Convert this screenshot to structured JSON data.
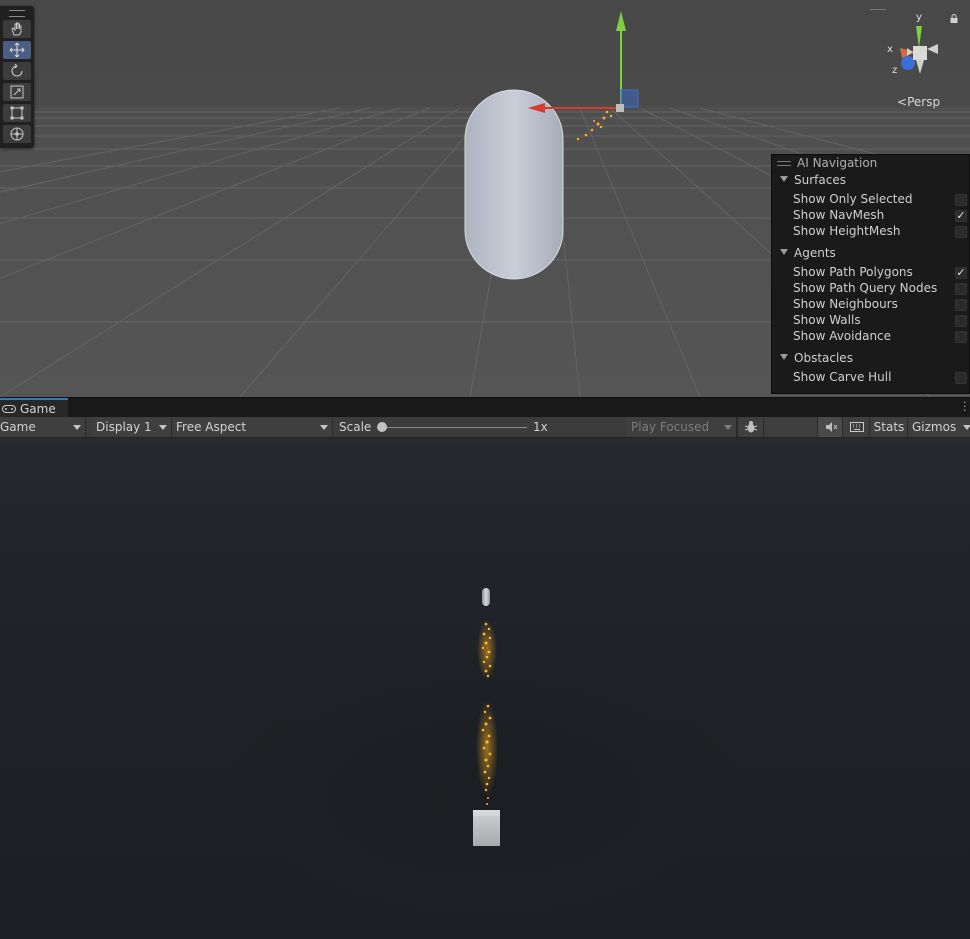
{
  "scene": {
    "camera_label": "Persp",
    "axis_labels": {
      "x": "x",
      "y": "y",
      "z": "z"
    },
    "tools": [
      {
        "name": "hand-tool",
        "icon": "hand-icon"
      },
      {
        "name": "move-tool",
        "icon": "move-icon",
        "active": true
      },
      {
        "name": "rotate-tool",
        "icon": "rotate-icon"
      },
      {
        "name": "scale-tool",
        "icon": "scale-icon"
      },
      {
        "name": "rect-tool",
        "icon": "rect-icon"
      },
      {
        "name": "transform-tool",
        "icon": "transform-icon"
      }
    ],
    "ai_navigation": {
      "title": "AI Navigation",
      "sections": [
        {
          "label": "Surfaces",
          "options": [
            {
              "label": "Show Only Selected",
              "checked": false
            },
            {
              "label": "Show NavMesh",
              "checked": true
            },
            {
              "label": "Show HeightMesh",
              "checked": false
            }
          ]
        },
        {
          "label": "Agents",
          "options": [
            {
              "label": "Show Path Polygons",
              "checked": true
            },
            {
              "label": "Show Path Query Nodes",
              "checked": false
            },
            {
              "label": "Show Neighbours",
              "checked": false
            },
            {
              "label": "Show Walls",
              "checked": false
            },
            {
              "label": "Show Avoidance",
              "checked": false
            }
          ]
        },
        {
          "label": "Obstacles",
          "options": [
            {
              "label": "Show Carve Hull",
              "checked": false
            }
          ]
        }
      ]
    }
  },
  "game": {
    "tab_label": "Game",
    "toolbar": {
      "view_mode": "Game",
      "display": "Display 1",
      "aspect": "Free Aspect",
      "scale_label": "Scale",
      "scale_value": "1x",
      "play_mode": "Play Focused",
      "stats_label": "Stats",
      "gizmos_label": "Gizmos"
    }
  },
  "colors": {
    "accent_tab": "#3a79bb",
    "axis_x": "#d63b2b",
    "axis_y": "#7bd13f",
    "axis_z": "#3b6fd6",
    "particle": "#ffb020"
  }
}
